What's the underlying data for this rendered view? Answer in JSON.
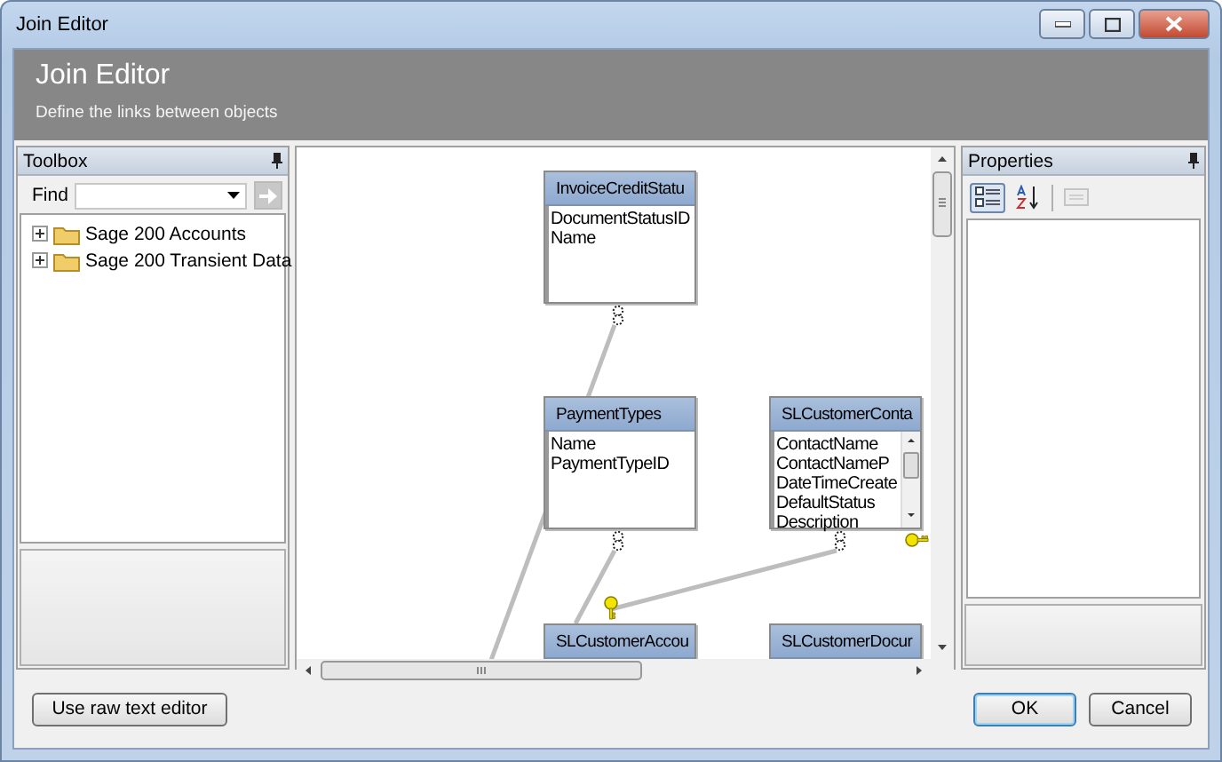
{
  "window": {
    "title": "Join Editor"
  },
  "header": {
    "title": "Join Editor",
    "subtitle": "Define the links between objects"
  },
  "toolbox": {
    "title": "Toolbox",
    "find_label": "Find",
    "go_button": {
      "disabled": true
    },
    "tree": [
      {
        "label": "Sage 200 Accounts",
        "expanded": false
      },
      {
        "label": "Sage 200 Transient Data",
        "expanded": false
      }
    ]
  },
  "canvas": {
    "entities": [
      {
        "title": "InvoiceCreditStatu",
        "fields": [
          "DocumentStatusID",
          "Name"
        ]
      },
      {
        "title": "PaymentTypes",
        "fields": [
          "Name",
          "PaymentTypeID"
        ]
      },
      {
        "title": "SLCustomerConta",
        "fields": [
          "ContactName",
          "ContactNameP",
          "DateTimeCreate",
          "DefaultStatus",
          "Description"
        ]
      },
      {
        "title": "SLCustomerAccou"
      },
      {
        "title": "SLCustomerDocur"
      }
    ]
  },
  "properties": {
    "title": "Properties",
    "toolbar": [
      {
        "kind": "categorized",
        "selected": true,
        "disabled": false
      },
      {
        "kind": "alphabetical",
        "selected": false,
        "disabled": false
      },
      {
        "kind": "pages",
        "selected": false,
        "disabled": true
      }
    ]
  },
  "footer": {
    "raw_editor_button": "Use raw text editor",
    "buttons": [
      {
        "label": "OK",
        "default": true
      },
      {
        "label": "Cancel",
        "default": false
      }
    ]
  }
}
